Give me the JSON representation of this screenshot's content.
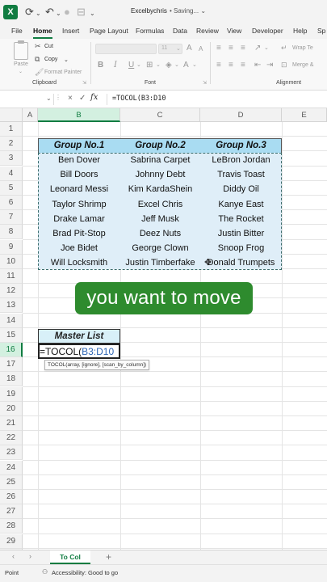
{
  "titlebar": {
    "app_icon": "excel-logo-icon",
    "app_letter": "X",
    "doc_title": "Excelbychris",
    "status": "• Saving... ⌄"
  },
  "menu": {
    "tabs": [
      "File",
      "Home",
      "Insert",
      "Page Layout",
      "Formulas",
      "Data",
      "Review",
      "View",
      "Developer",
      "Help",
      "Sp"
    ],
    "active_tab": "Home"
  },
  "ribbon": {
    "clipboard": {
      "paste_label": "Paste",
      "cut_label": "Cut",
      "copy_label": "Copy",
      "format_painter_label": "Format Painter",
      "group_label": "Clipboard"
    },
    "font": {
      "size_value": "11",
      "bold": "B",
      "italic": "I",
      "underline": "U",
      "grow": "A",
      "shrink": "A",
      "group_label": "Font"
    },
    "alignment": {
      "wrap_text": "Wrap Te",
      "merge": "Merge &",
      "group_label": "Alignment"
    }
  },
  "formula_bar": {
    "name_box": "",
    "cancel_icon": "×",
    "enter_icon": "✓",
    "fx_label": "fx",
    "formula": "=TOCOL(B3:D10"
  },
  "grid": {
    "columns": [
      "A",
      "B",
      "C",
      "D",
      "E"
    ],
    "selected_column": "B",
    "rows": [
      "1",
      "2",
      "3",
      "4",
      "5",
      "6",
      "7",
      "8",
      "9",
      "10",
      "11",
      "12",
      "13",
      "14",
      "15",
      "16",
      "17",
      "18",
      "19",
      "20",
      "21",
      "22",
      "23",
      "24",
      "25",
      "26",
      "27",
      "28",
      "29",
      "30"
    ],
    "selected_row": "16",
    "table": {
      "headers": [
        "Group  No.1",
        "Group  No.2",
        "Group  No.3"
      ],
      "rows": [
        [
          "Ben Dover",
          "Sabrina Carpet",
          "LeBron Jordan"
        ],
        [
          "Bill Doors",
          "Johnny Debt",
          "Travis Toast"
        ],
        [
          "Leonard Messi",
          "Kim KardaShein",
          "Diddy Oil"
        ],
        [
          "Taylor Shrimp",
          "Excel Chris",
          "Kanye East"
        ],
        [
          "Drake Lamar",
          "Jeff Musk",
          "The Rocket"
        ],
        [
          "Brad Pit-Stop",
          "Deez Nuts",
          "Justin Bitter"
        ],
        [
          "Joe Bidet",
          "George Clown",
          "Snoop Frog"
        ],
        [
          "Will Locksmith",
          "Justin Timberfake",
          "Donald Trumpets"
        ]
      ]
    },
    "master_list_label": "Master List",
    "active_cell": {
      "func": "=TOCOL(",
      "ref": "B3:D10"
    },
    "tooltip": "TOCOL(array, [ignore], [scan_by_column])"
  },
  "caption": "you want to move",
  "sheet_tabs": {
    "prev": "‹",
    "next": "›",
    "tabs": [
      "To Col"
    ],
    "add": "+"
  },
  "status_bar": {
    "mode": "Point",
    "accessibility": "Accessibility: Good to go"
  },
  "colors": {
    "accent": "#107c41",
    "table_header": "#a9dcf2",
    "table_body": "#dfeef8",
    "caption_bg": "#2e8b2e"
  }
}
